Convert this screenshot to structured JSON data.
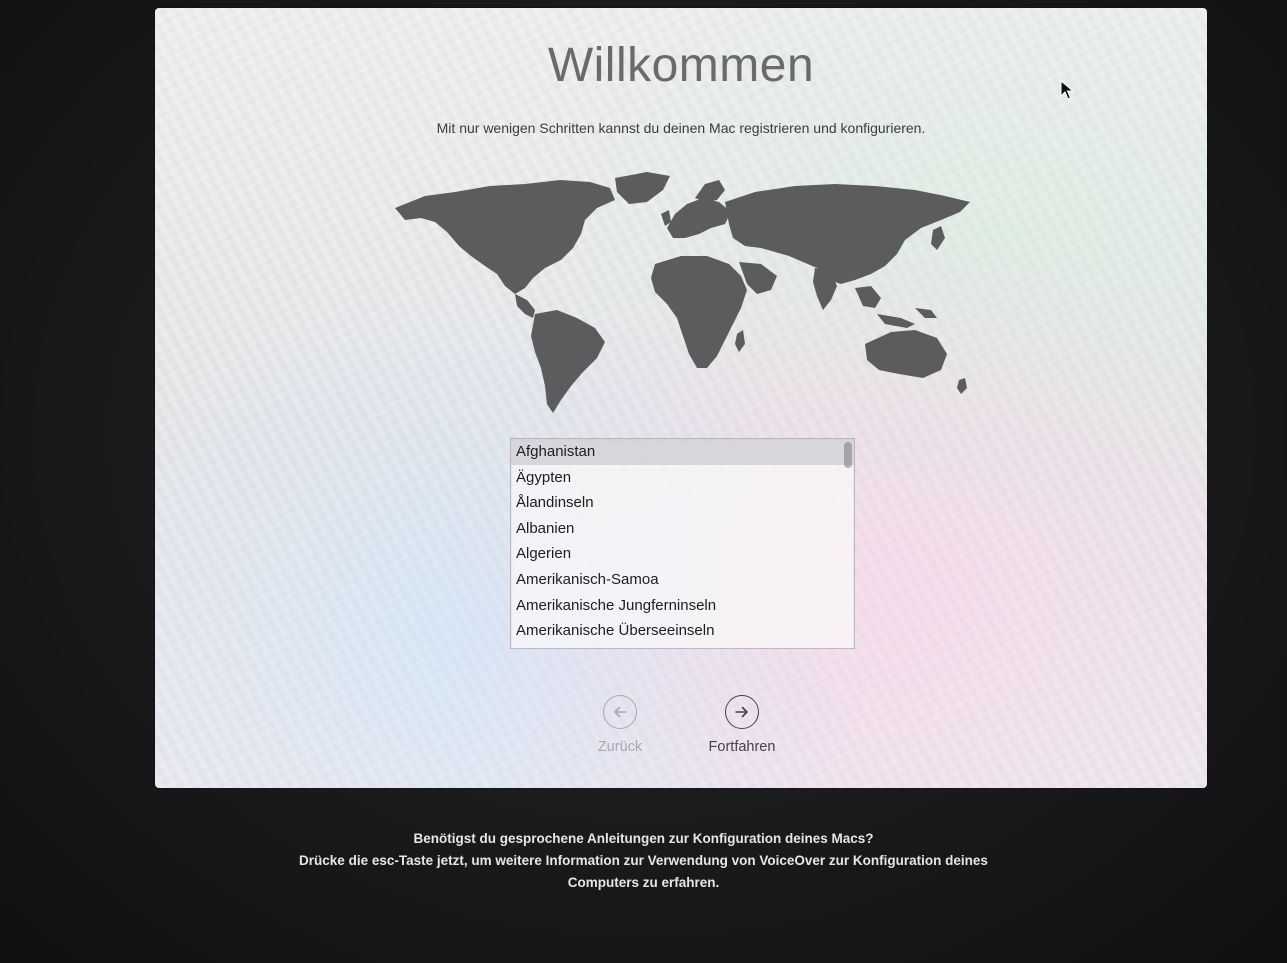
{
  "welcome": {
    "title": "Willkommen",
    "subtitle": "Mit nur wenigen Schritten kannst du deinen Mac registrieren und konfigurieren."
  },
  "country_list": {
    "items": [
      "Afghanistan",
      "Ägypten",
      "Ålandinseln",
      "Albanien",
      "Algerien",
      "Amerikanisch-Samoa",
      "Amerikanische Jungferninseln",
      "Amerikanische Überseeinseln"
    ],
    "selected": "Afghanistan"
  },
  "navigation": {
    "back_label": "Zurück",
    "back_icon": "arrow-left-circle-icon",
    "continue_label": "Fortfahren",
    "continue_icon": "arrow-right-circle-icon"
  },
  "voiceover_hint": {
    "line1": "Benötigst du gesprochene Anleitungen zur Konfiguration deines Macs?",
    "line2": "Drücke die esc-Taste jetzt, um weitere Information zur Verwendung von VoiceOver zur Konfiguration deines",
    "line3": "Computers zu erfahren."
  },
  "colors": {
    "map_land": "#5c5c5e",
    "title_text": "#6a6a6c",
    "hint_text": "#e6e6e6"
  }
}
